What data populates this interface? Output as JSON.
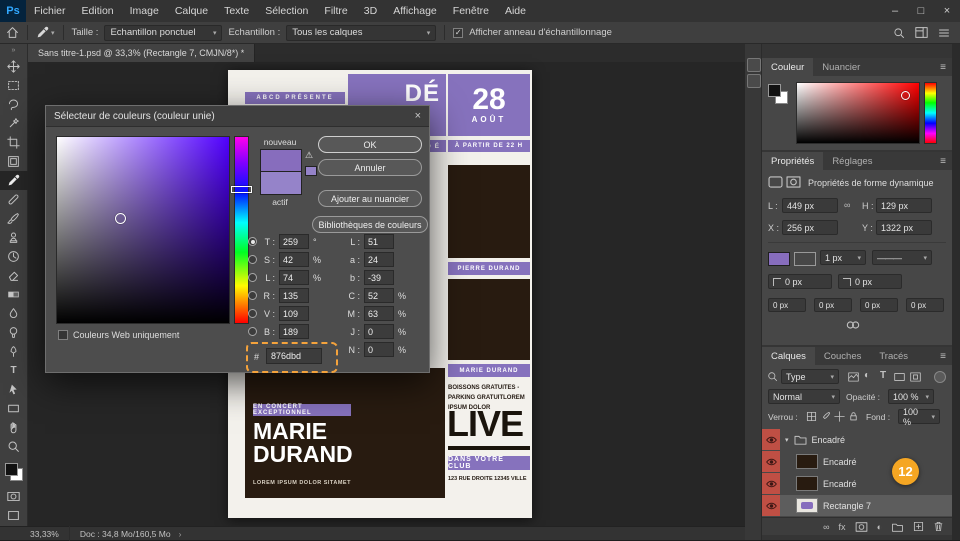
{
  "colors": {
    "accent_purple": "#876dbd",
    "current_color": "#9583c9",
    "poster_purple": "#8672bd",
    "photo_brown": "#281b10",
    "badge_orange": "#f5a623",
    "eye_red": "#bf4f44",
    "selected_hue": "hsl(259,100%,50%)"
  },
  "icons": {
    "caret_down": "▾",
    "caret_expand": "▾",
    "menu": "≡",
    "warning": "⚠",
    "collapse": "»",
    "chevron": "›",
    "link": "∞",
    "fx": "fx",
    "half_circle": "◐",
    "type": "T",
    "line": "———",
    "check": "✓"
  },
  "menubar": {
    "logo": "Ps",
    "items": [
      "Fichier",
      "Edition",
      "Image",
      "Calque",
      "Texte",
      "Sélection",
      "Filtre",
      "3D",
      "Affichage",
      "Fenêtre",
      "Aide"
    ],
    "minimize": "–",
    "maximize": "□",
    "close": "×"
  },
  "options_bar": {
    "taille_label": "Taille :",
    "taille_value": "Echantillon ponctuel",
    "sample_label": "Echantillon :",
    "sample_value": "Tous les calques",
    "ring_checkbox_label": "Afficher anneau d'échantillonnage"
  },
  "document_tab": {
    "title": "Sans titre-1.psd @ 33,3% (Rectangle 7, CMJN/8*) *"
  },
  "color_picker": {
    "title": "Sélecteur de couleurs (couleur unie)",
    "close": "×",
    "new_label": "nouveau",
    "current_label": "actif",
    "ok": "OK",
    "cancel": "Annuler",
    "add_to_swatches": "Ajouter au nuancier",
    "color_libraries": "Bibliothèques de couleurs",
    "web_only": "Couleurs Web uniquement",
    "hex_prefix": "#",
    "hex": "876dbd",
    "hsl": {
      "t_label": "T :",
      "t": "259",
      "t_unit": "°",
      "s_label": "S :",
      "s": "42",
      "s_unit": "%",
      "l_label": "L :",
      "l": "74",
      "l_unit": "%"
    },
    "rgb": {
      "r_label": "R :",
      "r": "135",
      "v_label": "V :",
      "v": "109",
      "b_label": "B :",
      "b": "189"
    },
    "lab": {
      "l_label": "L :",
      "l": "51",
      "a_label": "a :",
      "a": "24",
      "b_label": "b :",
      "b": "-39"
    },
    "cmyk": {
      "c_label": "C :",
      "c": "52",
      "m_label": "M :",
      "m": "63",
      "j_label": "J :",
      "j": "0",
      "n_label": "N :",
      "n": "0",
      "unit": "%"
    }
  },
  "poster": {
    "presents": "ABCD PRÉSENTE",
    "headline_fragment": "DÉ",
    "subline_fragment": "D É",
    "day": "28",
    "month": "AOÛT",
    "time": "À PARTIR DE 22 H",
    "artist_top": "PIERRE DURAND",
    "artist_bottom": "MARIE DURAND",
    "info": "BOISSONS GRATUITES - PARKING GRATUITLOREM IPSUM DOLOR",
    "live": "LIVE",
    "club": "DANS VOTRE CLUB",
    "address": "123 RUE DROITE 12345 VILLE",
    "concert_label": "EN CONCERT EXCEPTIONNEL",
    "name_line1": "MARIE",
    "name_line2": "DURAND",
    "lorem": "LOREM IPSUM DOLOR SITAMET"
  },
  "color_panel": {
    "tab_color": "Couleur",
    "tab_swatches": "Nuancier"
  },
  "properties_panel": {
    "tab_properties": "Propriétés",
    "tab_adjustments": "Réglages",
    "header": "Propriétés de forme dynamique",
    "w_label": "L :",
    "w_value": "449 px",
    "h_label": "H :",
    "h_value": "129 px",
    "x_label": "X :",
    "x_value": "256 px",
    "y_label": "Y :",
    "y_value": "1322 px",
    "stroke_width": "1 px",
    "radius_value": "0 px"
  },
  "layers_panel": {
    "tab_layers": "Calques",
    "tab_channels": "Couches",
    "tab_paths": "Tracés",
    "filter_label": "Type",
    "blend_mode": "Normal",
    "opacity_label": "Opacité :",
    "opacity_value": "100 %",
    "lock_label": "Verrou :",
    "fill_label": "Fond :",
    "fill_value": "100 %",
    "rows": [
      {
        "name": "Encadré",
        "kind": "group"
      },
      {
        "name": "Encadré",
        "kind": "layer"
      },
      {
        "name": "Encadré",
        "kind": "layer"
      },
      {
        "name": "Rectangle 7",
        "kind": "shape",
        "selected": true
      }
    ]
  },
  "status_bar": {
    "zoom": "33,33%",
    "doc": "Doc : 34,8 Mo/160,5 Mo"
  },
  "annotation_badge": "12"
}
